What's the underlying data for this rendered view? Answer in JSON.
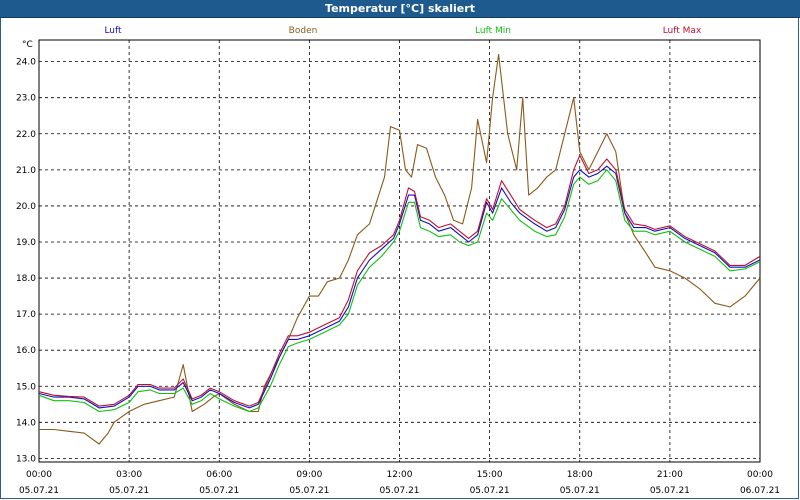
{
  "window": {
    "title": "Temperatur [°C] skaliert"
  },
  "chart_data": {
    "type": "line",
    "title": "Temperatur [°C] skaliert",
    "ylabel": "°C",
    "xlabel": "",
    "ylim": [
      12.9,
      24.6
    ],
    "xlim": [
      0,
      24
    ],
    "grid": true,
    "legend_placement": "top",
    "yticks": [
      "13.0",
      "14.0",
      "15.0",
      "16.0",
      "17.0",
      "18.0",
      "19.0",
      "20.0",
      "21.0",
      "22.0",
      "23.0",
      "24.0"
    ],
    "xticks": [
      {
        "time": "00:00",
        "date": "05.07.21"
      },
      {
        "time": "03:00",
        "date": "05.07.21"
      },
      {
        "time": "06:00",
        "date": "05.07.21"
      },
      {
        "time": "09:00",
        "date": "05.07.21"
      },
      {
        "time": "12:00",
        "date": "05.07.21"
      },
      {
        "time": "15:00",
        "date": "05.07.21"
      },
      {
        "time": "18:00",
        "date": "05.07.21"
      },
      {
        "time": "21:00",
        "date": "05.07.21"
      },
      {
        "time": "00:00",
        "date": "06.07.21"
      }
    ],
    "series": [
      {
        "name": "Luft",
        "color": "#1010c0",
        "points": [
          [
            0,
            14.8
          ],
          [
            0.5,
            14.7
          ],
          [
            1,
            14.7
          ],
          [
            1.5,
            14.65
          ],
          [
            2,
            14.4
          ],
          [
            2.5,
            14.45
          ],
          [
            3,
            14.7
          ],
          [
            3.3,
            15.0
          ],
          [
            3.7,
            15.0
          ],
          [
            4,
            14.9
          ],
          [
            4.5,
            14.9
          ],
          [
            4.8,
            15.1
          ],
          [
            5.1,
            14.6
          ],
          [
            5.4,
            14.7
          ],
          [
            5.7,
            14.9
          ],
          [
            6,
            14.8
          ],
          [
            6.5,
            14.55
          ],
          [
            7,
            14.4
          ],
          [
            7.3,
            14.5
          ],
          [
            7.7,
            15.2
          ],
          [
            8,
            15.8
          ],
          [
            8.3,
            16.3
          ],
          [
            8.6,
            16.3
          ],
          [
            9,
            16.4
          ],
          [
            9.5,
            16.6
          ],
          [
            10,
            16.8
          ],
          [
            10.3,
            17.2
          ],
          [
            10.6,
            18.0
          ],
          [
            11,
            18.5
          ],
          [
            11.4,
            18.8
          ],
          [
            11.8,
            19.1
          ],
          [
            12,
            19.5
          ],
          [
            12.3,
            20.3
          ],
          [
            12.5,
            20.3
          ],
          [
            12.7,
            19.6
          ],
          [
            13,
            19.5
          ],
          [
            13.3,
            19.3
          ],
          [
            13.7,
            19.4
          ],
          [
            14,
            19.2
          ],
          [
            14.3,
            19.0
          ],
          [
            14.6,
            19.2
          ],
          [
            14.9,
            20.1
          ],
          [
            15.1,
            19.8
          ],
          [
            15.4,
            20.5
          ],
          [
            15.7,
            20.1
          ],
          [
            16,
            19.8
          ],
          [
            16.5,
            19.5
          ],
          [
            16.9,
            19.3
          ],
          [
            17.2,
            19.4
          ],
          [
            17.5,
            19.9
          ],
          [
            17.8,
            20.8
          ],
          [
            18,
            21.0
          ],
          [
            18.3,
            20.8
          ],
          [
            18.6,
            20.9
          ],
          [
            18.9,
            21.1
          ],
          [
            19.2,
            20.9
          ],
          [
            19.5,
            19.8
          ],
          [
            19.8,
            19.4
          ],
          [
            20.2,
            19.4
          ],
          [
            20.5,
            19.3
          ],
          [
            21,
            19.4
          ],
          [
            21.5,
            19.1
          ],
          [
            22,
            18.9
          ],
          [
            22.5,
            18.7
          ],
          [
            23,
            18.3
          ],
          [
            23.5,
            18.3
          ],
          [
            24,
            18.5
          ]
        ]
      },
      {
        "name": "Boden",
        "color": "#8b5a1a",
        "points": [
          [
            0,
            13.8
          ],
          [
            0.5,
            13.8
          ],
          [
            1,
            13.75
          ],
          [
            1.5,
            13.7
          ],
          [
            2,
            13.4
          ],
          [
            2.3,
            13.7
          ],
          [
            2.5,
            14.0
          ],
          [
            3,
            14.3
          ],
          [
            3.5,
            14.5
          ],
          [
            4,
            14.6
          ],
          [
            4.5,
            14.7
          ],
          [
            4.8,
            15.6
          ],
          [
            5.1,
            14.3
          ],
          [
            5.5,
            14.5
          ],
          [
            5.8,
            14.7
          ],
          [
            6,
            14.8
          ],
          [
            6.5,
            14.5
          ],
          [
            7,
            14.3
          ],
          [
            7.3,
            14.3
          ],
          [
            7.5,
            15.0
          ],
          [
            8,
            15.8
          ],
          [
            8.3,
            16.3
          ],
          [
            8.6,
            16.9
          ],
          [
            9,
            17.5
          ],
          [
            9.3,
            17.5
          ],
          [
            9.6,
            17.9
          ],
          [
            10,
            18.0
          ],
          [
            10.3,
            18.5
          ],
          [
            10.6,
            19.2
          ],
          [
            11,
            19.5
          ],
          [
            11.5,
            20.8
          ],
          [
            11.7,
            22.2
          ],
          [
            12,
            22.1
          ],
          [
            12.2,
            21.0
          ],
          [
            12.4,
            20.8
          ],
          [
            12.6,
            21.7
          ],
          [
            12.9,
            21.6
          ],
          [
            13.2,
            20.8
          ],
          [
            13.5,
            20.3
          ],
          [
            13.8,
            19.6
          ],
          [
            14.1,
            19.5
          ],
          [
            14.4,
            20.5
          ],
          [
            14.6,
            22.4
          ],
          [
            14.9,
            21.2
          ],
          [
            15.1,
            23.0
          ],
          [
            15.3,
            24.2
          ],
          [
            15.6,
            22.0
          ],
          [
            15.9,
            21.0
          ],
          [
            16.1,
            23.0
          ],
          [
            16.3,
            20.3
          ],
          [
            16.6,
            20.5
          ],
          [
            16.9,
            20.8
          ],
          [
            17.2,
            21.0
          ],
          [
            17.5,
            22.0
          ],
          [
            17.8,
            23.0
          ],
          [
            18,
            21.5
          ],
          [
            18.3,
            21.0
          ],
          [
            18.6,
            21.5
          ],
          [
            18.9,
            22.0
          ],
          [
            19.2,
            21.5
          ],
          [
            19.5,
            19.8
          ],
          [
            19.8,
            19.2
          ],
          [
            20.2,
            18.7
          ],
          [
            20.5,
            18.3
          ],
          [
            21,
            18.2
          ],
          [
            21.5,
            18.0
          ],
          [
            22,
            17.7
          ],
          [
            22.5,
            17.3
          ],
          [
            23,
            17.2
          ],
          [
            23.5,
            17.5
          ],
          [
            24,
            18.0
          ]
        ]
      },
      {
        "name": "Luft Min",
        "color": "#10c010",
        "points": [
          [
            0,
            14.75
          ],
          [
            0.5,
            14.6
          ],
          [
            1,
            14.6
          ],
          [
            1.5,
            14.55
          ],
          [
            2,
            14.3
          ],
          [
            2.5,
            14.35
          ],
          [
            3,
            14.55
          ],
          [
            3.3,
            14.85
          ],
          [
            3.7,
            14.9
          ],
          [
            4,
            14.8
          ],
          [
            4.5,
            14.8
          ],
          [
            4.8,
            14.95
          ],
          [
            5.1,
            14.5
          ],
          [
            5.4,
            14.6
          ],
          [
            5.7,
            14.8
          ],
          [
            6,
            14.65
          ],
          [
            6.5,
            14.45
          ],
          [
            7,
            14.3
          ],
          [
            7.3,
            14.4
          ],
          [
            7.7,
            15.0
          ],
          [
            8,
            15.6
          ],
          [
            8.3,
            16.1
          ],
          [
            8.6,
            16.2
          ],
          [
            9,
            16.3
          ],
          [
            9.5,
            16.5
          ],
          [
            10,
            16.7
          ],
          [
            10.3,
            17.0
          ],
          [
            10.6,
            17.8
          ],
          [
            11,
            18.3
          ],
          [
            11.4,
            18.6
          ],
          [
            11.8,
            19.0
          ],
          [
            12,
            19.3
          ],
          [
            12.3,
            20.1
          ],
          [
            12.5,
            20.1
          ],
          [
            12.7,
            19.4
          ],
          [
            13,
            19.3
          ],
          [
            13.3,
            19.15
          ],
          [
            13.7,
            19.2
          ],
          [
            14,
            19.0
          ],
          [
            14.3,
            18.9
          ],
          [
            14.6,
            19.0
          ],
          [
            14.9,
            19.8
          ],
          [
            15.1,
            19.6
          ],
          [
            15.4,
            20.2
          ],
          [
            15.7,
            19.9
          ],
          [
            16,
            19.6
          ],
          [
            16.5,
            19.3
          ],
          [
            16.9,
            19.15
          ],
          [
            17.2,
            19.2
          ],
          [
            17.5,
            19.7
          ],
          [
            17.8,
            20.6
          ],
          [
            18,
            20.8
          ],
          [
            18.3,
            20.6
          ],
          [
            18.6,
            20.7
          ],
          [
            18.9,
            21.0
          ],
          [
            19.2,
            20.7
          ],
          [
            19.5,
            19.6
          ],
          [
            19.8,
            19.3
          ],
          [
            20.2,
            19.3
          ],
          [
            20.5,
            19.2
          ],
          [
            21,
            19.3
          ],
          [
            21.5,
            19.0
          ],
          [
            22,
            18.8
          ],
          [
            22.5,
            18.6
          ],
          [
            23,
            18.2
          ],
          [
            23.5,
            18.25
          ],
          [
            24,
            18.45
          ]
        ]
      },
      {
        "name": "Luft Max",
        "color": "#c01030",
        "points": [
          [
            0,
            14.85
          ],
          [
            0.5,
            14.75
          ],
          [
            1,
            14.72
          ],
          [
            1.5,
            14.7
          ],
          [
            2,
            14.45
          ],
          [
            2.5,
            14.5
          ],
          [
            3,
            14.75
          ],
          [
            3.3,
            15.05
          ],
          [
            3.7,
            15.05
          ],
          [
            4,
            14.95
          ],
          [
            4.5,
            14.95
          ],
          [
            4.8,
            15.2
          ],
          [
            5.1,
            14.65
          ],
          [
            5.4,
            14.75
          ],
          [
            5.7,
            14.95
          ],
          [
            6,
            14.85
          ],
          [
            6.5,
            14.6
          ],
          [
            7,
            14.45
          ],
          [
            7.3,
            14.55
          ],
          [
            7.7,
            15.3
          ],
          [
            8,
            15.9
          ],
          [
            8.3,
            16.4
          ],
          [
            8.6,
            16.4
          ],
          [
            9,
            16.5
          ],
          [
            9.5,
            16.7
          ],
          [
            10,
            16.9
          ],
          [
            10.3,
            17.4
          ],
          [
            10.6,
            18.2
          ],
          [
            11,
            18.7
          ],
          [
            11.4,
            18.9
          ],
          [
            11.8,
            19.2
          ],
          [
            12,
            19.6
          ],
          [
            12.3,
            20.5
          ],
          [
            12.5,
            20.4
          ],
          [
            12.7,
            19.7
          ],
          [
            13,
            19.6
          ],
          [
            13.3,
            19.4
          ],
          [
            13.7,
            19.5
          ],
          [
            14,
            19.3
          ],
          [
            14.3,
            19.1
          ],
          [
            14.6,
            19.3
          ],
          [
            14.9,
            20.2
          ],
          [
            15.1,
            19.9
          ],
          [
            15.4,
            20.7
          ],
          [
            15.7,
            20.3
          ],
          [
            16,
            19.9
          ],
          [
            16.5,
            19.6
          ],
          [
            16.9,
            19.4
          ],
          [
            17.2,
            19.5
          ],
          [
            17.5,
            20.0
          ],
          [
            17.8,
            21.0
          ],
          [
            18,
            21.4
          ],
          [
            18.3,
            20.9
          ],
          [
            18.6,
            21.0
          ],
          [
            18.9,
            21.3
          ],
          [
            19.2,
            21.0
          ],
          [
            19.5,
            19.9
          ],
          [
            19.8,
            19.5
          ],
          [
            20.2,
            19.45
          ],
          [
            20.5,
            19.35
          ],
          [
            21,
            19.45
          ],
          [
            21.5,
            19.15
          ],
          [
            22,
            18.95
          ],
          [
            22.5,
            18.75
          ],
          [
            23,
            18.35
          ],
          [
            23.5,
            18.35
          ],
          [
            24,
            18.6
          ]
        ]
      }
    ]
  }
}
